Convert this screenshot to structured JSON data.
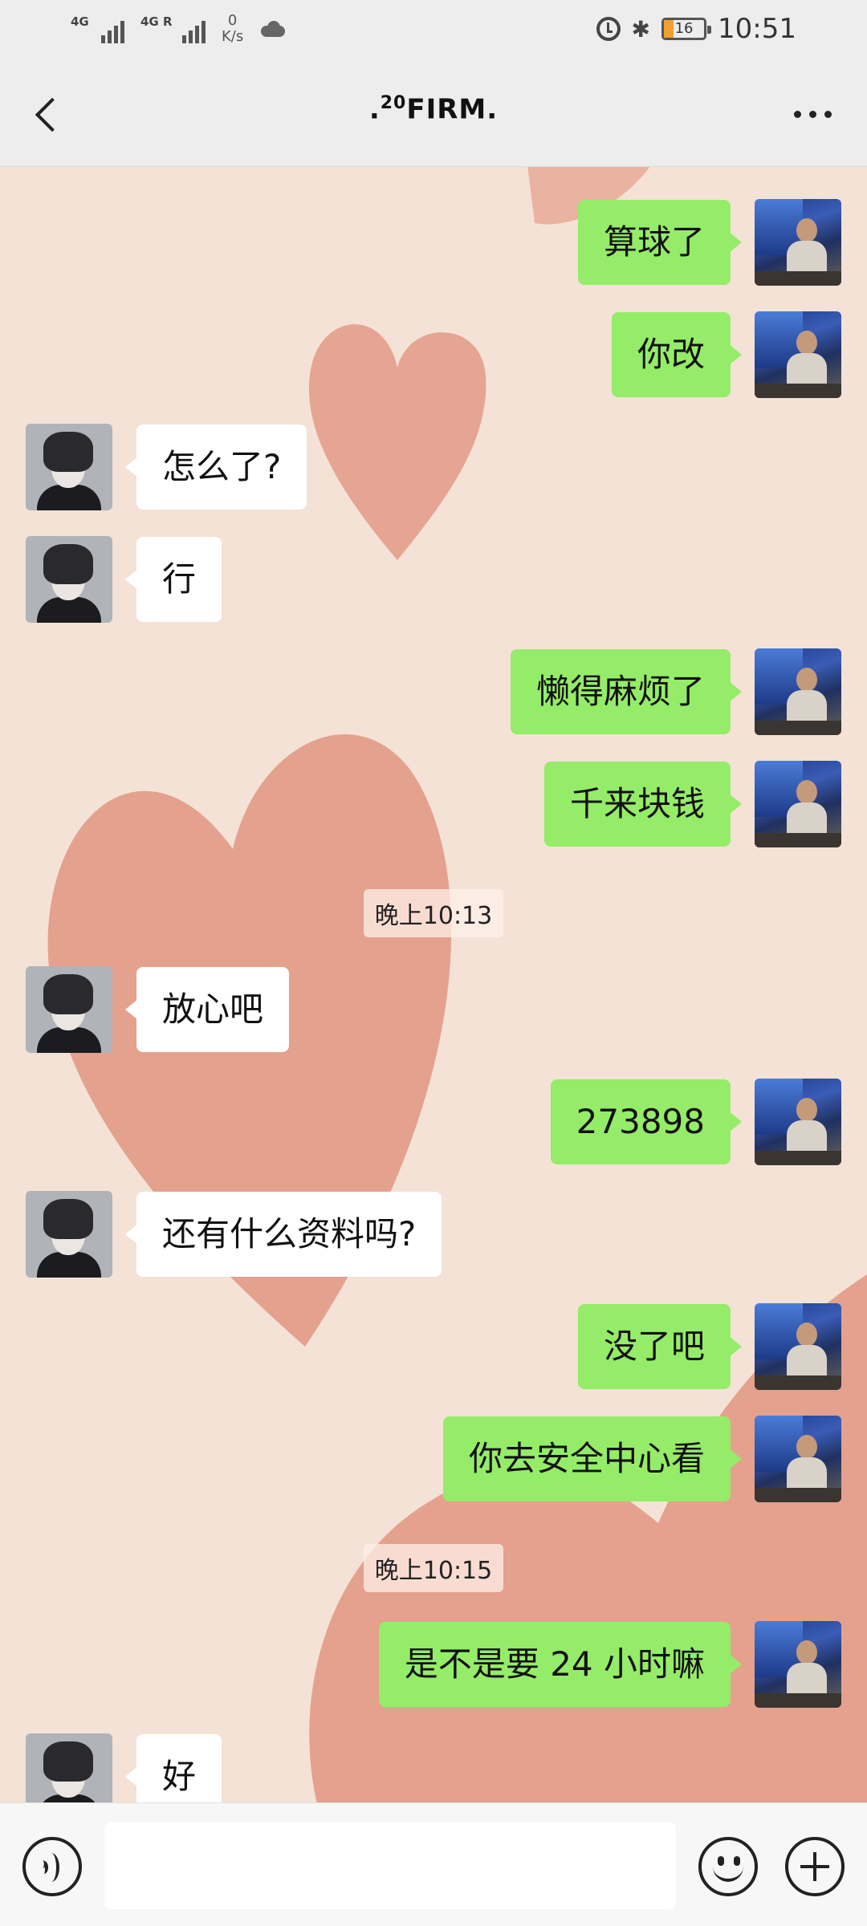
{
  "status_bar": {
    "signal1_label": "4G",
    "signal2_label": "4G R",
    "speed_value": "0",
    "speed_unit": "K/s",
    "battery": "16",
    "time": "10:51"
  },
  "header": {
    "title_prefix": ".",
    "title_sup": "20",
    "title_main": "FIRM."
  },
  "messages": [
    {
      "side": "right",
      "text": "算球了"
    },
    {
      "side": "right",
      "text": "你改"
    },
    {
      "side": "left",
      "text": "怎么了?"
    },
    {
      "side": "left",
      "text": "行"
    },
    {
      "side": "right",
      "text": "懒得麻烦了"
    },
    {
      "side": "right",
      "text": "千来块钱"
    },
    {
      "side": "time",
      "text": "晚上10:13"
    },
    {
      "side": "left",
      "text": "放心吧"
    },
    {
      "side": "right",
      "text": "273898"
    },
    {
      "side": "left",
      "text": "还有什么资料吗?"
    },
    {
      "side": "right",
      "text": "没了吧"
    },
    {
      "side": "right",
      "text": "你去安全中心看"
    },
    {
      "side": "time",
      "text": "晚上10:15"
    },
    {
      "side": "right",
      "text": "是不是要 24 小时嘛"
    },
    {
      "side": "left",
      "text": "好"
    }
  ],
  "colors": {
    "bubble_self": "#95ec69",
    "bubble_other": "#ffffff",
    "heart": "#e29a86",
    "background": "#f4e2d6"
  },
  "icons": {
    "back": "chevron-left-icon",
    "more": "more-dots-icon",
    "voice": "voice-icon",
    "emoji": "emoji-icon",
    "add": "plus-circle-icon"
  }
}
